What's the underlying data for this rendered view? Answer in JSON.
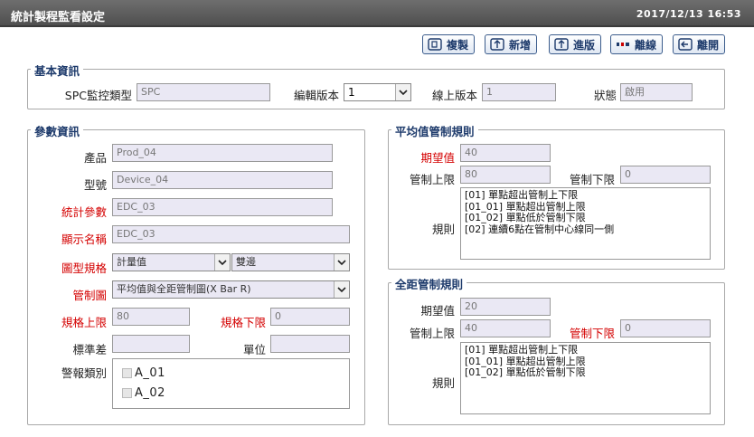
{
  "header": {
    "title": "統計製程監看設定",
    "datetime": "2017/12/13 16:53"
  },
  "toolbar": {
    "copy": "複製",
    "add": "新增",
    "enter": "進版",
    "offline": "離線",
    "leave": "離開"
  },
  "basic": {
    "legend": "基本資訊",
    "spc_type_label": "SPC監控類型",
    "spc_type_value": "SPC",
    "edit_version_label": "編輯版本",
    "edit_version_value": "1",
    "online_version_label": "線上版本",
    "online_version_value": "1",
    "status_label": "狀態",
    "status_value": "啟用"
  },
  "params": {
    "legend": "參數資訊",
    "product_label": "產品",
    "product_value": "Prod_04",
    "model_label": "型號",
    "model_value": "Device_04",
    "stat_param_label": "統計參數",
    "stat_param_value": "EDC_03",
    "display_name_label": "顯示名稱",
    "display_name_value": "EDC_03",
    "chart_spec_label": "圖型規格",
    "chart_spec_value1": "計量值",
    "chart_spec_value2": "雙邊",
    "control_chart_label": "管制圖",
    "control_chart_value": "平均值與全距管制圖(X Bar R)",
    "usl_label": "規格上限",
    "usl_value": "80",
    "lsl_label": "規格下限",
    "lsl_value": "0",
    "std_label": "標準差",
    "std_value": "",
    "unit_label": "單位",
    "unit_value": "",
    "alarm_label": "警報類別",
    "alarms": [
      "A_01",
      "A_02"
    ]
  },
  "mean_rules": {
    "legend": "平均值管制規則",
    "target_label": "期望值",
    "target_value": "40",
    "ucl_label": "管制上限",
    "ucl_value": "80",
    "lcl_label": "管制下限",
    "lcl_value": "0",
    "rules_label": "規則",
    "rules": [
      "[01] 單點超出管制上下限",
      "[01_01] 單點超出管制上限",
      "[01_02] 單點低於管制下限",
      "[02] 連續6點在管制中心線同一側"
    ]
  },
  "range_rules": {
    "legend": "全距管制規則",
    "target_label": "期望值",
    "target_value": "20",
    "ucl_label": "管制上限",
    "ucl_value": "40",
    "lcl_label": "管制下限",
    "lcl_value": "0",
    "rules_label": "規則",
    "rules": [
      "[01] 單點超出管制上下限",
      "[01_01] 單點超出管制上限",
      "[01_02] 單點低於管制下限"
    ]
  }
}
